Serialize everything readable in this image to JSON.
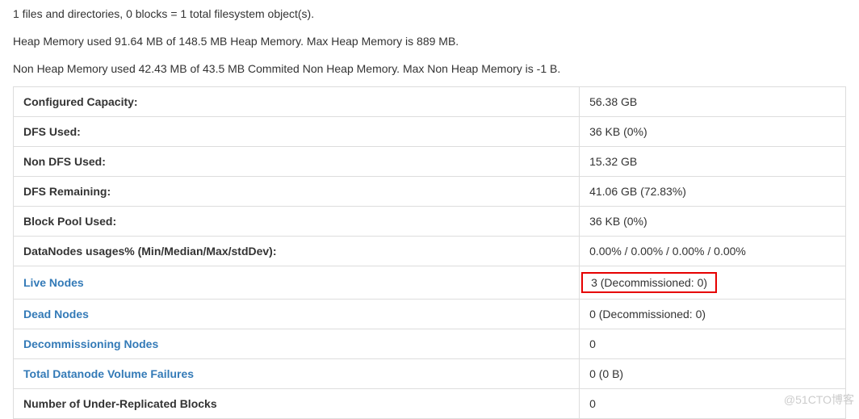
{
  "summary": {
    "files_line": "1 files and directories, 0 blocks = 1 total filesystem object(s).",
    "heap_line": "Heap Memory used 91.64 MB of 148.5 MB Heap Memory. Max Heap Memory is 889 MB.",
    "nonheap_line": "Non Heap Memory used 42.43 MB of 43.5 MB Commited Non Heap Memory. Max Non Heap Memory is -1 B."
  },
  "rows": {
    "configured_capacity": {
      "label": "Configured Capacity:",
      "value": "56.38 GB"
    },
    "dfs_used": {
      "label": "DFS Used:",
      "value": "36 KB (0%)"
    },
    "non_dfs_used": {
      "label": "Non DFS Used:",
      "value": "15.32 GB"
    },
    "dfs_remaining": {
      "label": "DFS Remaining:",
      "value": "41.06 GB (72.83%)"
    },
    "block_pool_used": {
      "label": "Block Pool Used:",
      "value": "36 KB (0%)"
    },
    "datanodes_usages": {
      "label": "DataNodes usages% (Min/Median/Max/stdDev):",
      "value": "0.00% / 0.00% / 0.00% / 0.00%"
    },
    "live_nodes": {
      "label": "Live Nodes",
      "value": "3 (Decommissioned: 0)"
    },
    "dead_nodes": {
      "label": "Dead Nodes",
      "value": "0 (Decommissioned: 0)"
    },
    "decommissioning": {
      "label": "Decommissioning Nodes",
      "value": "0"
    },
    "volume_failures": {
      "label": "Total Datanode Volume Failures",
      "value": "0 (0 B)"
    },
    "under_replicated": {
      "label": "Number of Under-Replicated Blocks",
      "value": "0"
    }
  },
  "watermark": "@51CTO博客"
}
